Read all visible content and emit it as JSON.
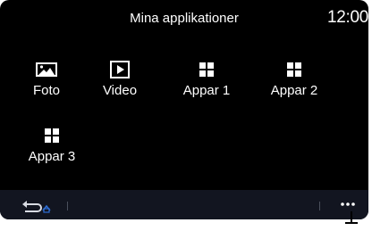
{
  "header": {
    "title": "Mina applikationer",
    "clock": "12:00"
  },
  "apps": [
    {
      "label": "Foto",
      "icon": "photo-icon"
    },
    {
      "label": "Video",
      "icon": "video-play-icon"
    },
    {
      "label": "Appar 1",
      "icon": "app-grid-icon"
    },
    {
      "label": "Appar 2",
      "icon": "app-grid-icon"
    },
    {
      "label": "Appar 3",
      "icon": "app-grid-icon"
    }
  ],
  "footer": {
    "back_icon": "back-arrow-icon",
    "more_icon": "more-dots-icon"
  },
  "colors": {
    "background": "#000000",
    "footer_background": "#121520",
    "text": "#ffffff",
    "accent": "#2f6fd6"
  }
}
